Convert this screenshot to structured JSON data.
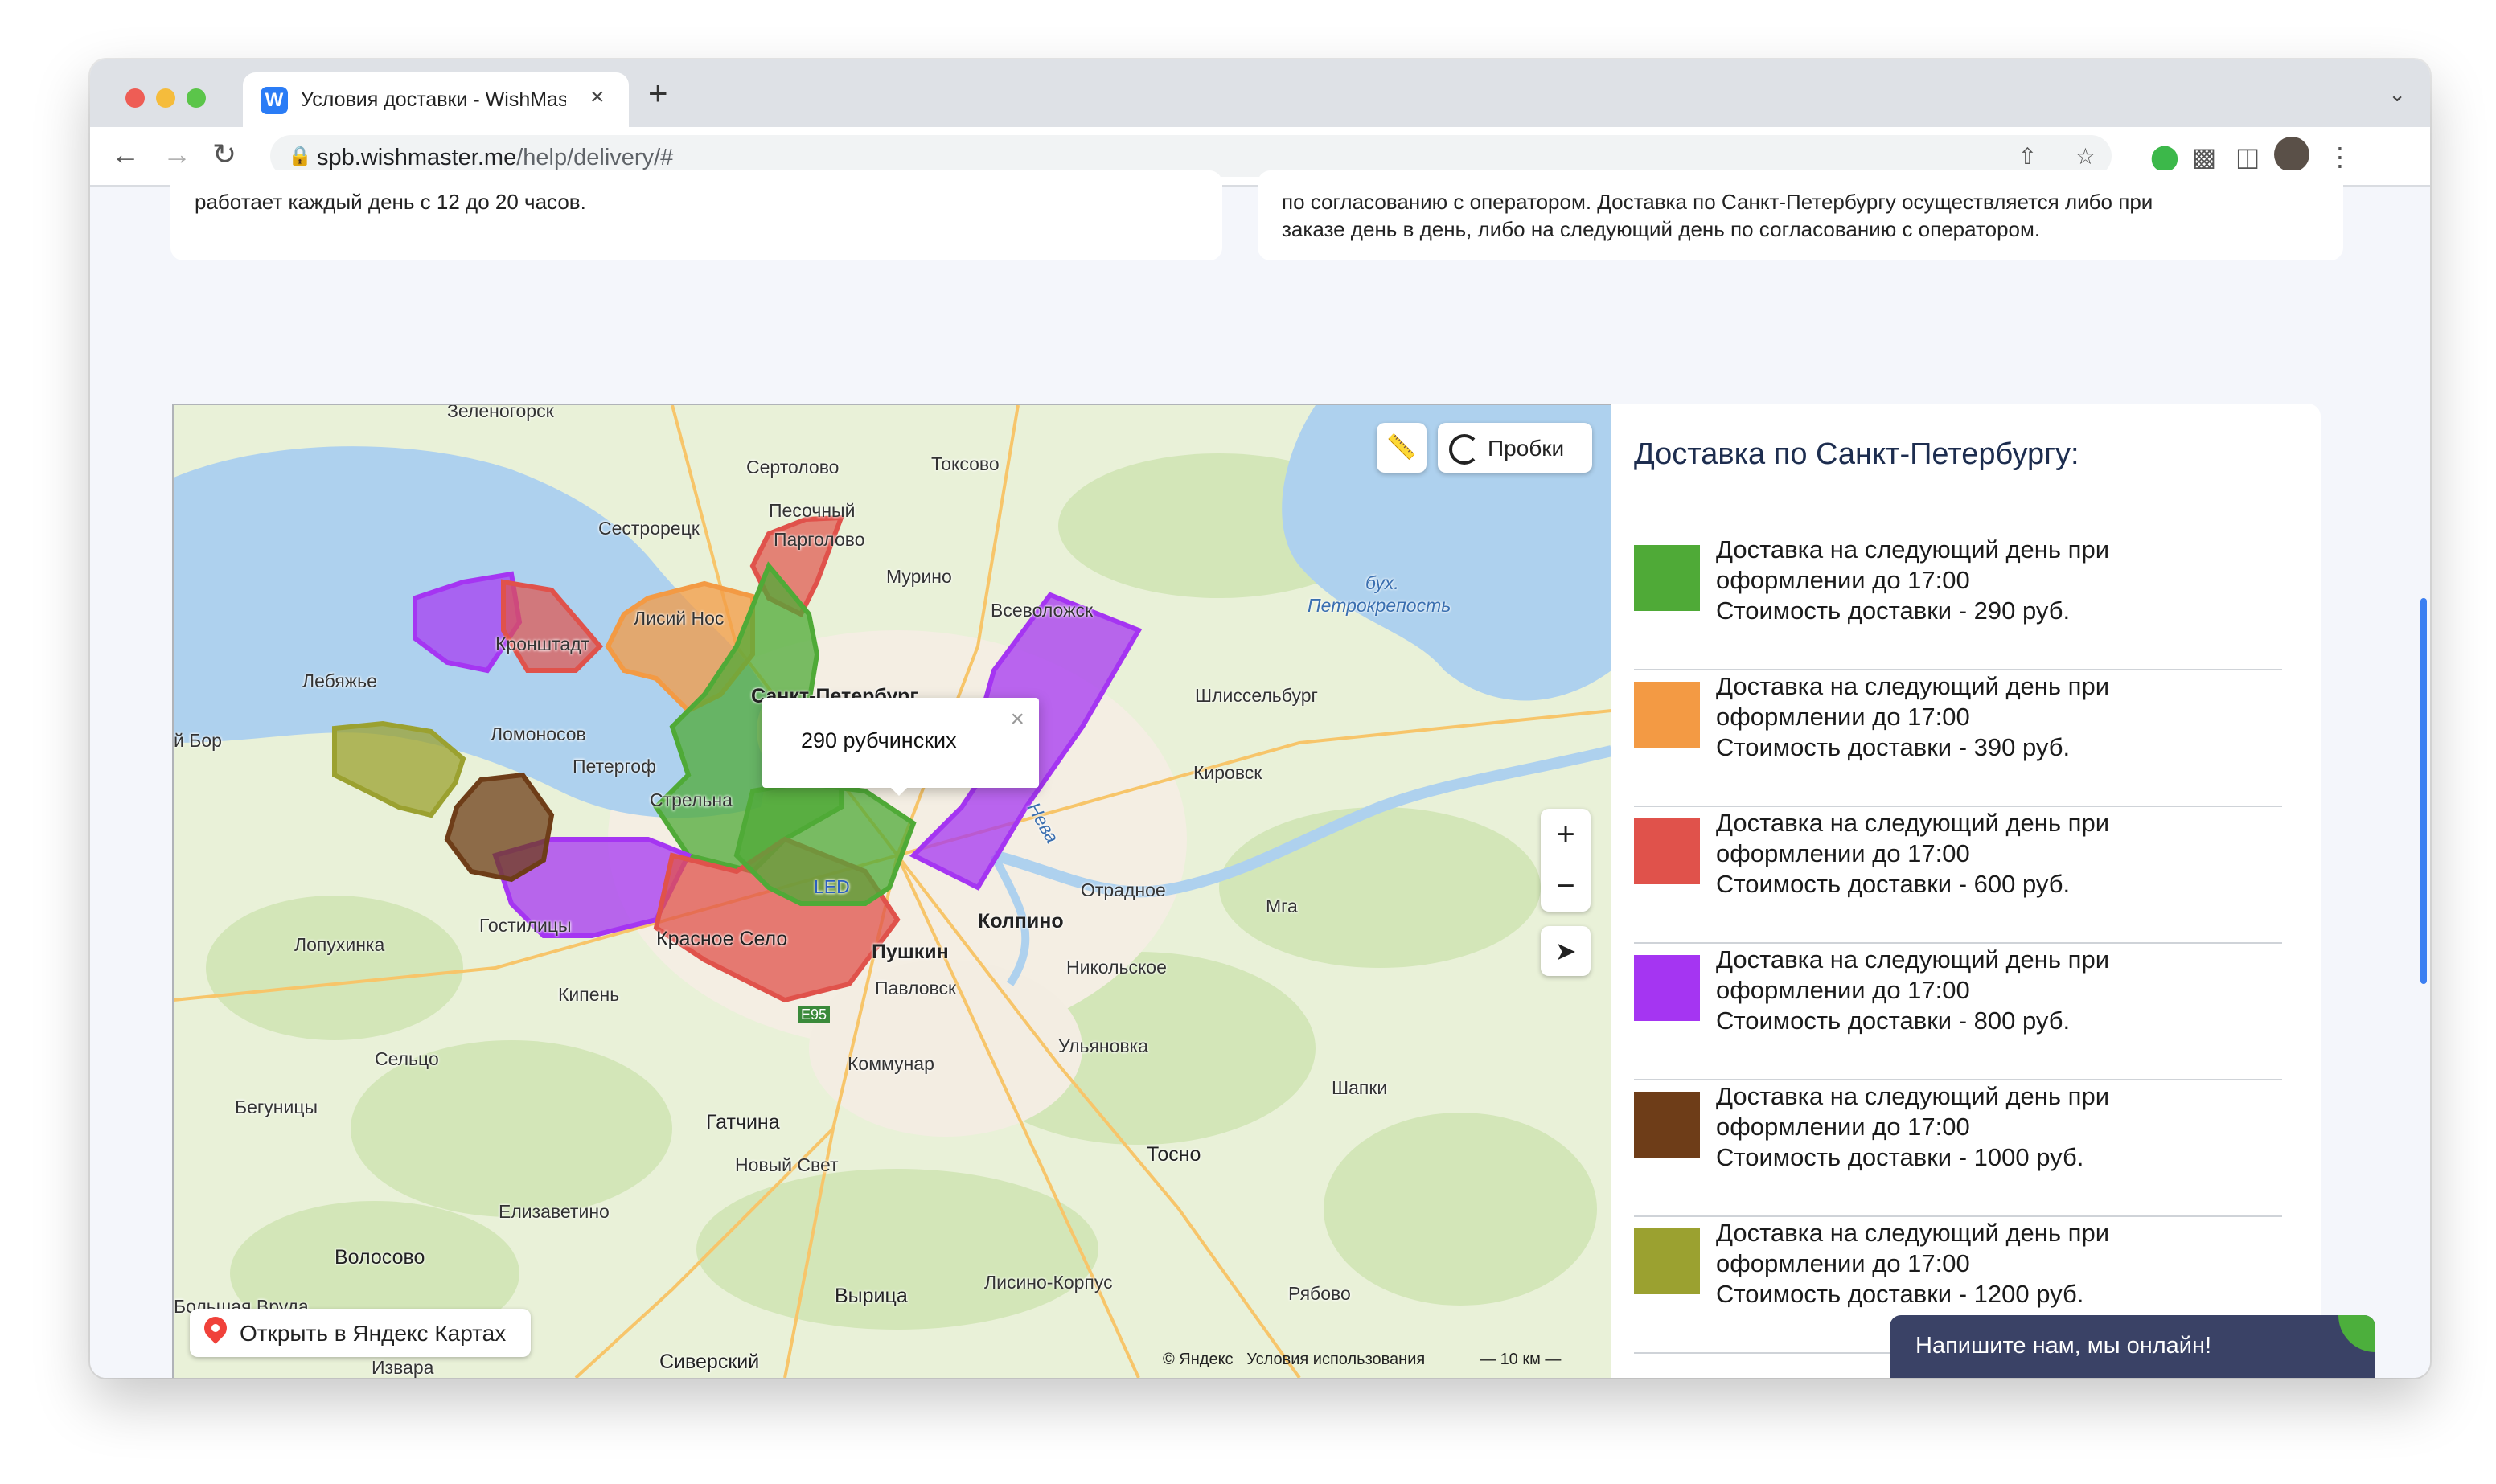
{
  "browser": {
    "tab_title": "Условия доставки - WishMaster",
    "tab_close": "×",
    "new_tab": "+",
    "url_host": "spb.wishmaster.me",
    "url_path": "/help/delivery/#"
  },
  "top_cards": {
    "left_text": "работает каждый день с 12 до 20 часов.",
    "right_line1": "по согласованию с оператором. Доставка по Санкт-Петербургу осуществляется либо при",
    "right_line2": "заказе день в день, либо на следующий день по согласованию с оператором."
  },
  "map": {
    "traffic_label": "Пробки",
    "open_in_maps": "Открыть в Яндекс Картах",
    "copyright": "© Яндекс",
    "terms": "Условия использования",
    "scale": "10 км",
    "zoom_in": "+",
    "zoom_out": "−",
    "popup_text": "290 рубчинских",
    "popup_close": "×",
    "places": {
      "zelenogorsk": "Зеленогорск",
      "sertolovo": "Сертолово",
      "toksovo": "Токсово",
      "pesochny": "Песочный",
      "sestroretsk": "Сестрорецк",
      "pargolovo": "Парголово",
      "murino": "Мурино",
      "vsevolozhsk": "Всеволожск",
      "lisiy_nos": "Лисий Нос",
      "kronshtadt": "Кронштадт",
      "lebyazhye": "Лебяжье",
      "spb": "Санкт-Петербург",
      "shlisselburg": "Шлиссельбург",
      "bukhta": "бух.",
      "petrokrepost": "Петрокрепость",
      "lomonosov": "Ломоносов",
      "petergof": "Петергоф",
      "strelna": "Стрельна",
      "kirovsk": "Кировск",
      "bor": "й Бор",
      "neva": "Нева",
      "led": "LED",
      "otradnoe": "Отрадное",
      "mga": "Мга",
      "lopukhinka": "Лопухинка",
      "gostilitsy": "Гостилицы",
      "krasnoe_selo": "Красное Село",
      "pushkin": "Пушкин",
      "kolpino": "Колпино",
      "pavlovsk": "Павловск",
      "nikolskoe": "Никольское",
      "kipen": "Кипень",
      "e95": "E95",
      "ulyanovka": "Ульяновка",
      "selco": "Сельцо",
      "kommunar": "Коммунар",
      "shapki": "Шапки",
      "begunitsy": "Бегуницы",
      "gatchina": "Гатчина",
      "novy_svet": "Новый Свет",
      "tosno": "Тосно",
      "elizavetino": "Елизаветино",
      "volosovo": "Волосово",
      "lisino": "Лисино-Корпус",
      "ryabovo": "Рябово",
      "bolshaya_vruda": "Большая Вруда",
      "vyritsa": "Вырица",
      "izvara": "Извара",
      "siversky": "Сиверский"
    }
  },
  "legend": {
    "title": "Доставка по Санкт-Петербургу:",
    "items": [
      {
        "line1": "Доставка на следующий день при",
        "line2": "оформлении до 17:00",
        "price": "Стоимость доставки - 290 руб.",
        "color": "#4faa37"
      },
      {
        "line1": "Доставка на следующий день при",
        "line2": "оформлении до 17:00",
        "price": "Стоимость доставки - 390 руб.",
        "color": "#f39a44"
      },
      {
        "line1": "Доставка на следующий день при",
        "line2": "оформлении до 17:00",
        "price": "Стоимость доставки - 600 руб.",
        "color": "#e0524b"
      },
      {
        "line1": "Доставка на следующий день при",
        "line2": "оформлении до 17:00",
        "price": "Стоимость доставки - 800 руб.",
        "color": "#a535f2"
      },
      {
        "line1": "Доставка на следующий день при",
        "line2": "оформлении до 17:00",
        "price": "Стоимость доставки - 1000 руб.",
        "color": "#6e3d18"
      },
      {
        "line1": "Доставка на следующий день при",
        "line2": "оформлении до 17:00",
        "price": "Стоимость доставки - 1200 руб.",
        "color": "#9ba130"
      }
    ]
  },
  "chat": {
    "label": "Напишите нам, мы онлайн!"
  }
}
